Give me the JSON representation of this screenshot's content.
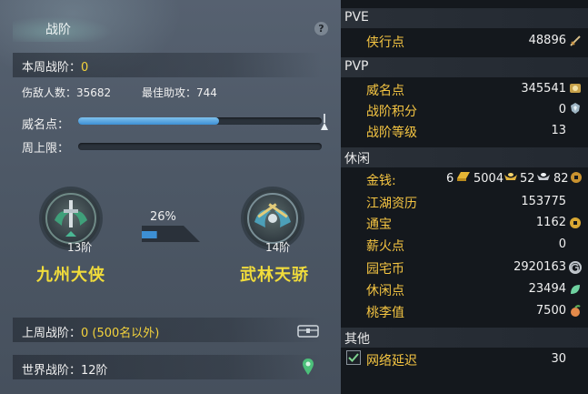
{
  "left_panel": {
    "title": "战阶",
    "help_icon": "?",
    "this_week": {
      "label": "本周战阶：",
      "value": "0"
    },
    "kills": {
      "label": "伤敌人数：",
      "value": "35682"
    },
    "assists": {
      "label": "最佳助攻：",
      "value": "744"
    },
    "prestige_label": "威名点：",
    "prestige_progress": 0.58,
    "weekly_cap_label": "周上限：",
    "weekly_cap_progress": 0,
    "current_rank": {
      "level": "13阶",
      "name": "九州大侠"
    },
    "next_rank": {
      "level": "14阶",
      "name": "武林天骄"
    },
    "rank_progress_text": "26%",
    "rank_progress": 0.26,
    "last_week": {
      "label": "上周战阶：",
      "value": "0 (500名以外)"
    },
    "world": {
      "label": "世界战阶：",
      "value": "12阶"
    }
  },
  "right_panel": {
    "pve": {
      "header": "PVE",
      "rows": [
        {
          "label": "侠行点",
          "value": "48896",
          "icon": "sword-icon"
        }
      ]
    },
    "pvp": {
      "header": "PVP",
      "rows": [
        {
          "label": "威名点",
          "value": "345541",
          "icon": "badge-icon"
        },
        {
          "label": "战阶积分",
          "value": "0",
          "icon": "crest-icon"
        },
        {
          "label": "战阶等级",
          "value": "13"
        }
      ]
    },
    "leisure": {
      "header": "休闲",
      "money_label": "金钱:",
      "money": {
        "gold_bar": "6",
        "ingot": "5004",
        "silver": "52",
        "copper": "82"
      },
      "rows": [
        {
          "label": "江湖资历",
          "value": "153775"
        },
        {
          "label": "通宝",
          "value": "1162",
          "icon": "coin-icon"
        },
        {
          "label": "薪火点",
          "value": "0"
        },
        {
          "label": "园宅币",
          "value": "2920163",
          "icon": "g-coin-icon"
        },
        {
          "label": "休闲点",
          "value": "23494",
          "icon": "leaf-icon"
        },
        {
          "label": "桃李值",
          "value": "7500",
          "icon": "peach-icon"
        }
      ]
    },
    "other": {
      "header": "其他",
      "rows": [
        {
          "label": "网络延迟",
          "value": "30",
          "checked": true
        }
      ]
    }
  },
  "colors": {
    "accent_yellow": "#f4d33c",
    "bar_blue": "#3d8fd3",
    "label_gold": "#f5c542"
  }
}
